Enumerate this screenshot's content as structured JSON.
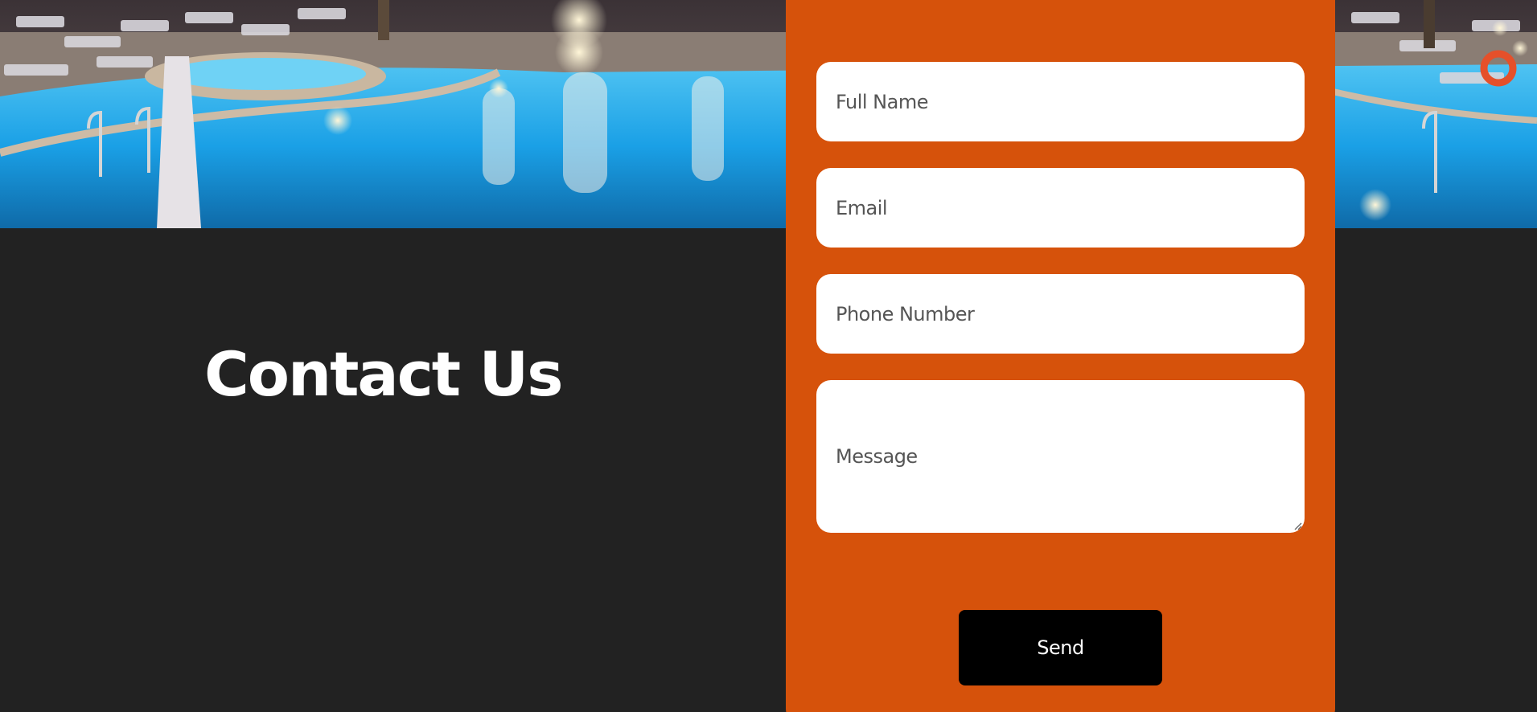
{
  "hero": {
    "image": "hotel-pool-at-night"
  },
  "contact": {
    "title": "Contact Us"
  },
  "form": {
    "full_name_placeholder": "Full Name",
    "email_placeholder": "Email",
    "phone_placeholder": "Phone Number",
    "message_placeholder": "Message",
    "send_label": "Send"
  },
  "colors": {
    "background": "#222222",
    "form_panel": "#d6520b",
    "field_background": "#ffffff",
    "button_background": "#000000",
    "button_text": "#ffffff",
    "title_text": "#ffffff"
  }
}
